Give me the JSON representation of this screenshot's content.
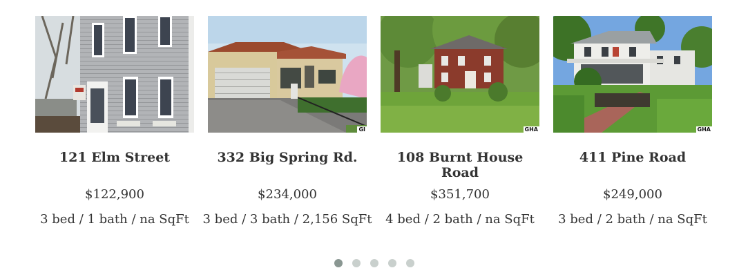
{
  "listings": [
    {
      "address": "121 Elm Street",
      "price": "$122,900",
      "beds": "3 bed",
      "baths": "1 bath",
      "sqft": "na SqFt",
      "badge": ""
    },
    {
      "address": "332 Big Spring Rd.",
      "price": "$234,000",
      "beds": "3 bed",
      "baths": "3 bath",
      "sqft": "2,156 SqFt",
      "badge": "GI"
    },
    {
      "address": "108 Burnt House Road",
      "price": "$351,700",
      "beds": "4 bed",
      "baths": "2 bath",
      "sqft": "na SqFt",
      "badge": "GHA"
    },
    {
      "address": "411 Pine Road",
      "price": "$249,000",
      "beds": "3 bed",
      "baths": "2 bath",
      "sqft": "na SqFt",
      "badge": "GHA"
    }
  ],
  "pagination": {
    "dots": [
      "page-1",
      "page-2",
      "page-3",
      "page-4",
      "page-5"
    ],
    "active_index": 0
  },
  "colors": {
    "dot_active": "#8a9792",
    "dot_inactive": "#c9d0cd",
    "text": "#333333"
  }
}
